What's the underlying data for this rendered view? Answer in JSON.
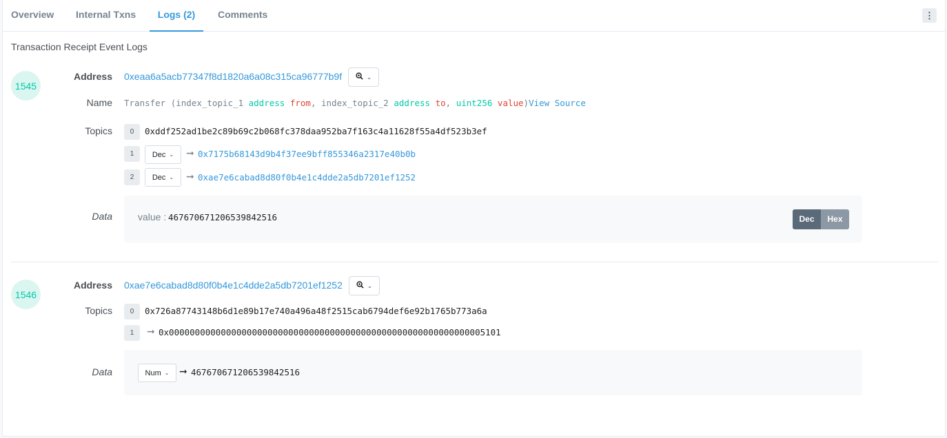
{
  "tabs": [
    "Overview",
    "Internal Txns",
    "Logs (2)",
    "Comments"
  ],
  "more_icon": "⋮",
  "section_title": "Transaction Receipt Event Logs",
  "labels": {
    "address": "Address",
    "name": "Name",
    "topics": "Topics",
    "data": "Data"
  },
  "logs": [
    {
      "number": "1545",
      "address": "0xeaa6a5acb77347f8d1820a6a08c315ca96777b9f",
      "name": {
        "prefix": "Transfer (index_topic_1 ",
        "t1": "address",
        "n1": " from",
        "sep1": ", index_topic_2 ",
        "t2": "address",
        "n2": " to",
        "sep2": ", ",
        "t3": "uint256",
        "n3": " value",
        "close": ")",
        "view_source": "View Source"
      },
      "topics": [
        {
          "index": "0",
          "value": "0xddf252ad1be2c89b69c2b068fc378daa952ba7f163c4a11628f55a4df523b3ef"
        },
        {
          "index": "1",
          "format": "Dec",
          "value": "0x7175b68143d9b4f37ee9bff855346a2317e40b0b"
        },
        {
          "index": "2",
          "format": "Dec",
          "value": "0xae7e6cabad8d80f0b4e1c4dde2a5db7201ef1252"
        }
      ],
      "data": {
        "key": "value : ",
        "value": "467670671206539842516",
        "dec_label": "Dec",
        "hex_label": "Hex"
      }
    },
    {
      "number": "1546",
      "address": "0xae7e6cabad8d80f0b4e1c4dde2a5db7201ef1252",
      "topics": [
        {
          "index": "0",
          "value": "0x726a87743148b6d1e89b17e740a496a48f2515cab6794def6e92b1765b773a6a"
        },
        {
          "index": "1",
          "value": "0x0000000000000000000000000000000000000000000000000000000000005101"
        }
      ],
      "data": {
        "format": "Num",
        "value": "467670671206539842516"
      }
    }
  ],
  "icons": {
    "zoom": "zoom-icon",
    "chevron": "chevron-down-icon",
    "arrow": "arrow-right-icon"
  },
  "colors": {
    "accent": "#3498db",
    "teal": "#00c9a7",
    "red": "#de4437"
  }
}
